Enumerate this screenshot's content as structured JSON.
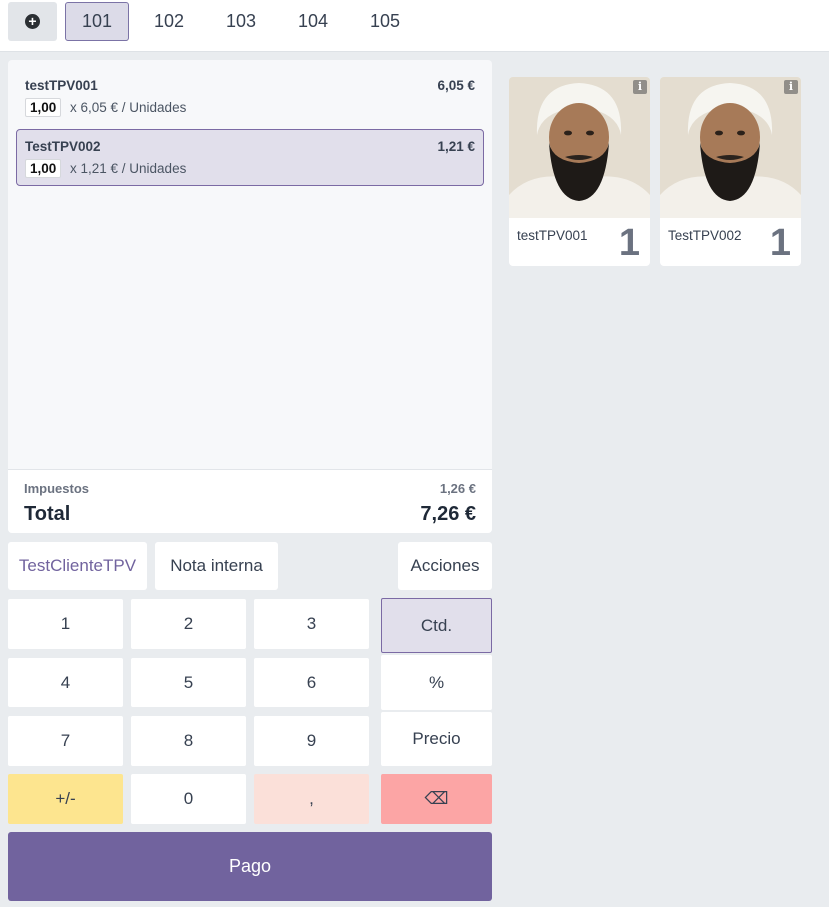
{
  "tabs": {
    "add_icon": "plus-circle-icon",
    "items": [
      "101",
      "102",
      "103",
      "104",
      "105"
    ],
    "active": "101"
  },
  "order": {
    "lines": [
      {
        "name": "testTPV001",
        "price": "6,05 €",
        "qty": "1,00",
        "unit_text": "x 6,05 € / Unidades",
        "selected": false
      },
      {
        "name": "TestTPV002",
        "price": "1,21 €",
        "qty": "1,00",
        "unit_text": "x 1,21 € / Unidades",
        "selected": true
      }
    ],
    "tax_label": "Impuestos",
    "tax_value": "1,26 €",
    "total_label": "Total",
    "total_value": "7,26 €"
  },
  "controls": {
    "customer": "TestClienteTPV",
    "note": "Nota interna",
    "actions": "Acciones"
  },
  "numpad": {
    "digits": [
      "1",
      "2",
      "3",
      "4",
      "5",
      "6",
      "7",
      "8",
      "9"
    ],
    "sign": "+/-",
    "zero": "0",
    "decimal": ",",
    "backspace": "⌫",
    "modes": [
      "Ctd.",
      "%",
      "Precio"
    ],
    "active_mode": "Ctd."
  },
  "pay_label": "Pago",
  "products": [
    {
      "name": "testTPV001",
      "count": "1",
      "info_icon": "info-icon"
    },
    {
      "name": "TestTPV002",
      "count": "1",
      "info_icon": "info-icon"
    }
  ],
  "colors": {
    "accent": "#71639e",
    "selected_bg": "#e1dfeb",
    "sign_key": "#fde58f",
    "comma_key": "#fbe0d9",
    "backspace_key": "#fca5a5"
  }
}
